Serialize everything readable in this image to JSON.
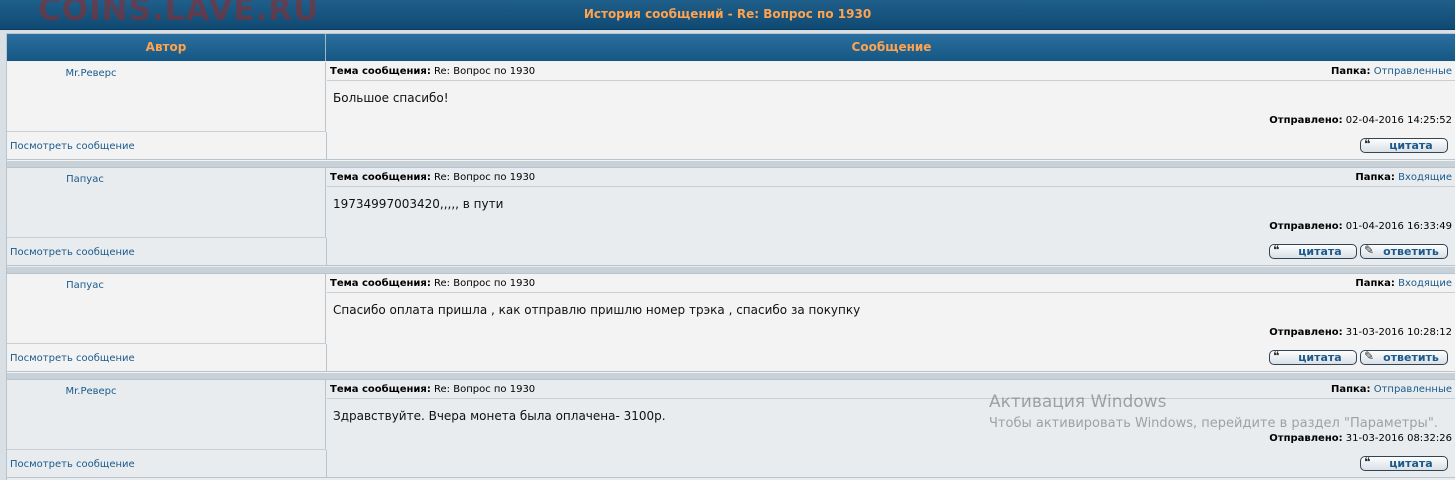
{
  "watermark": "COINS.LAVE.RU",
  "page_title": "История сообщений - Re: Вопрос по 1930",
  "columns": {
    "author": "Автор",
    "message": "Сообщение"
  },
  "labels": {
    "subject": "Тема сообщения:",
    "folder": "Папка:",
    "sent": "Отправлено:",
    "view_message": "Посмотреть сообщение",
    "quote": "цитата",
    "reply": "ответить"
  },
  "messages": [
    {
      "author": "Mr.Реверс",
      "subject": "Re: Вопрос по 1930",
      "folder": "Отправленные",
      "body": "Большое спасибо!",
      "sent": "02-04-2016 14:25:52"
    },
    {
      "author": "Папуас",
      "subject": "Re: Вопрос по 1930",
      "folder": "Входящие",
      "body": "19734997003420,,,,, в пути",
      "sent": "01-04-2016 16:33:49"
    },
    {
      "author": "Папуас",
      "subject": "Re: Вопрос по 1930",
      "folder": "Входящие",
      "body": "Спасибо оплата пришла , как отправлю пришлю номер трэка , спасибо за покупку",
      "sent": "31-03-2016 10:28:12"
    },
    {
      "author": "Mr.Реверс",
      "subject": "Re: Вопрос по 1930",
      "folder": "Отправленные",
      "body": "Здравствуйте. Вчера монета была оплачена- 3100р.",
      "sent": "31-03-2016 08:32:26"
    }
  ],
  "os_overlay": {
    "line1": "Активация Windows",
    "line2": "Чтобы активировать Windows, перейдите в раздел \"Параметры\"."
  }
}
